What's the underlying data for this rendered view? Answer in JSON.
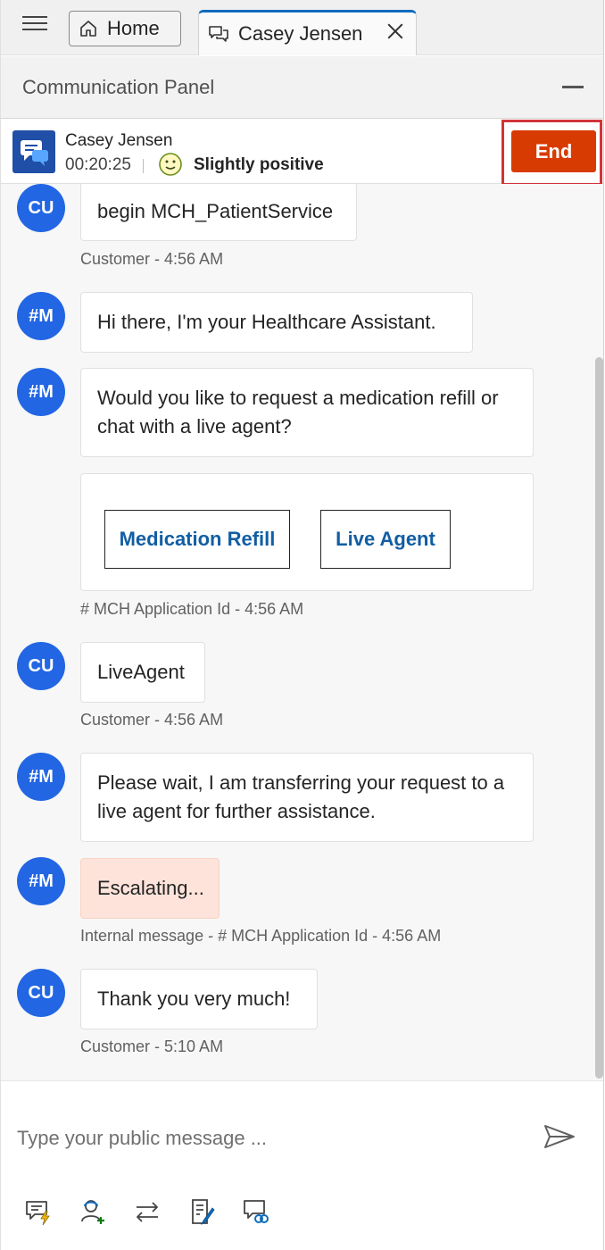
{
  "tabs": {
    "home_label": "Home",
    "session_label": "Casey Jensen"
  },
  "panel": {
    "title": "Communication Panel"
  },
  "session": {
    "customer_name": "Casey Jensen",
    "timer": "00:20:25",
    "sentiment": "Slightly positive",
    "end_label": "End"
  },
  "messages": [
    {
      "avatar": "CU",
      "text": "begin MCH_PatientService",
      "meta": "Customer - 4:56 AM"
    },
    {
      "avatar": "#M",
      "text": "Hi there, I'm your Healthcare Assistant."
    },
    {
      "avatar": "#M",
      "text": "Would you like to request a medication refill or chat with a live agent?"
    },
    {
      "card_buttons": [
        "Medication Refill",
        "Live Agent"
      ],
      "meta": "# MCH Application Id - 4:56 AM"
    },
    {
      "avatar": "CU",
      "text": "LiveAgent",
      "meta": "Customer - 4:56 AM"
    },
    {
      "avatar": "#M",
      "text": "Please wait, I am transferring your request to a live agent for further assistance."
    },
    {
      "avatar": "#M",
      "text": "Escalating...",
      "meta": "Internal message - # MCH Application Id - 4:56 AM"
    },
    {
      "avatar": "CU",
      "text": "Thank you very much!",
      "meta": "Customer - 5:10 AM"
    }
  ],
  "compose": {
    "placeholder": "Type your public message ..."
  },
  "toolbar_icons": [
    "quick-replies-icon",
    "consult-icon",
    "transfer-icon",
    "notes-icon",
    "link-conversation-icon"
  ],
  "colors": {
    "accent": "#0f6cbd",
    "end_button": "#d83b01",
    "avatar": "#2266e3",
    "internal_bubble": "#fde3da",
    "highlight_border": "#d13438"
  }
}
